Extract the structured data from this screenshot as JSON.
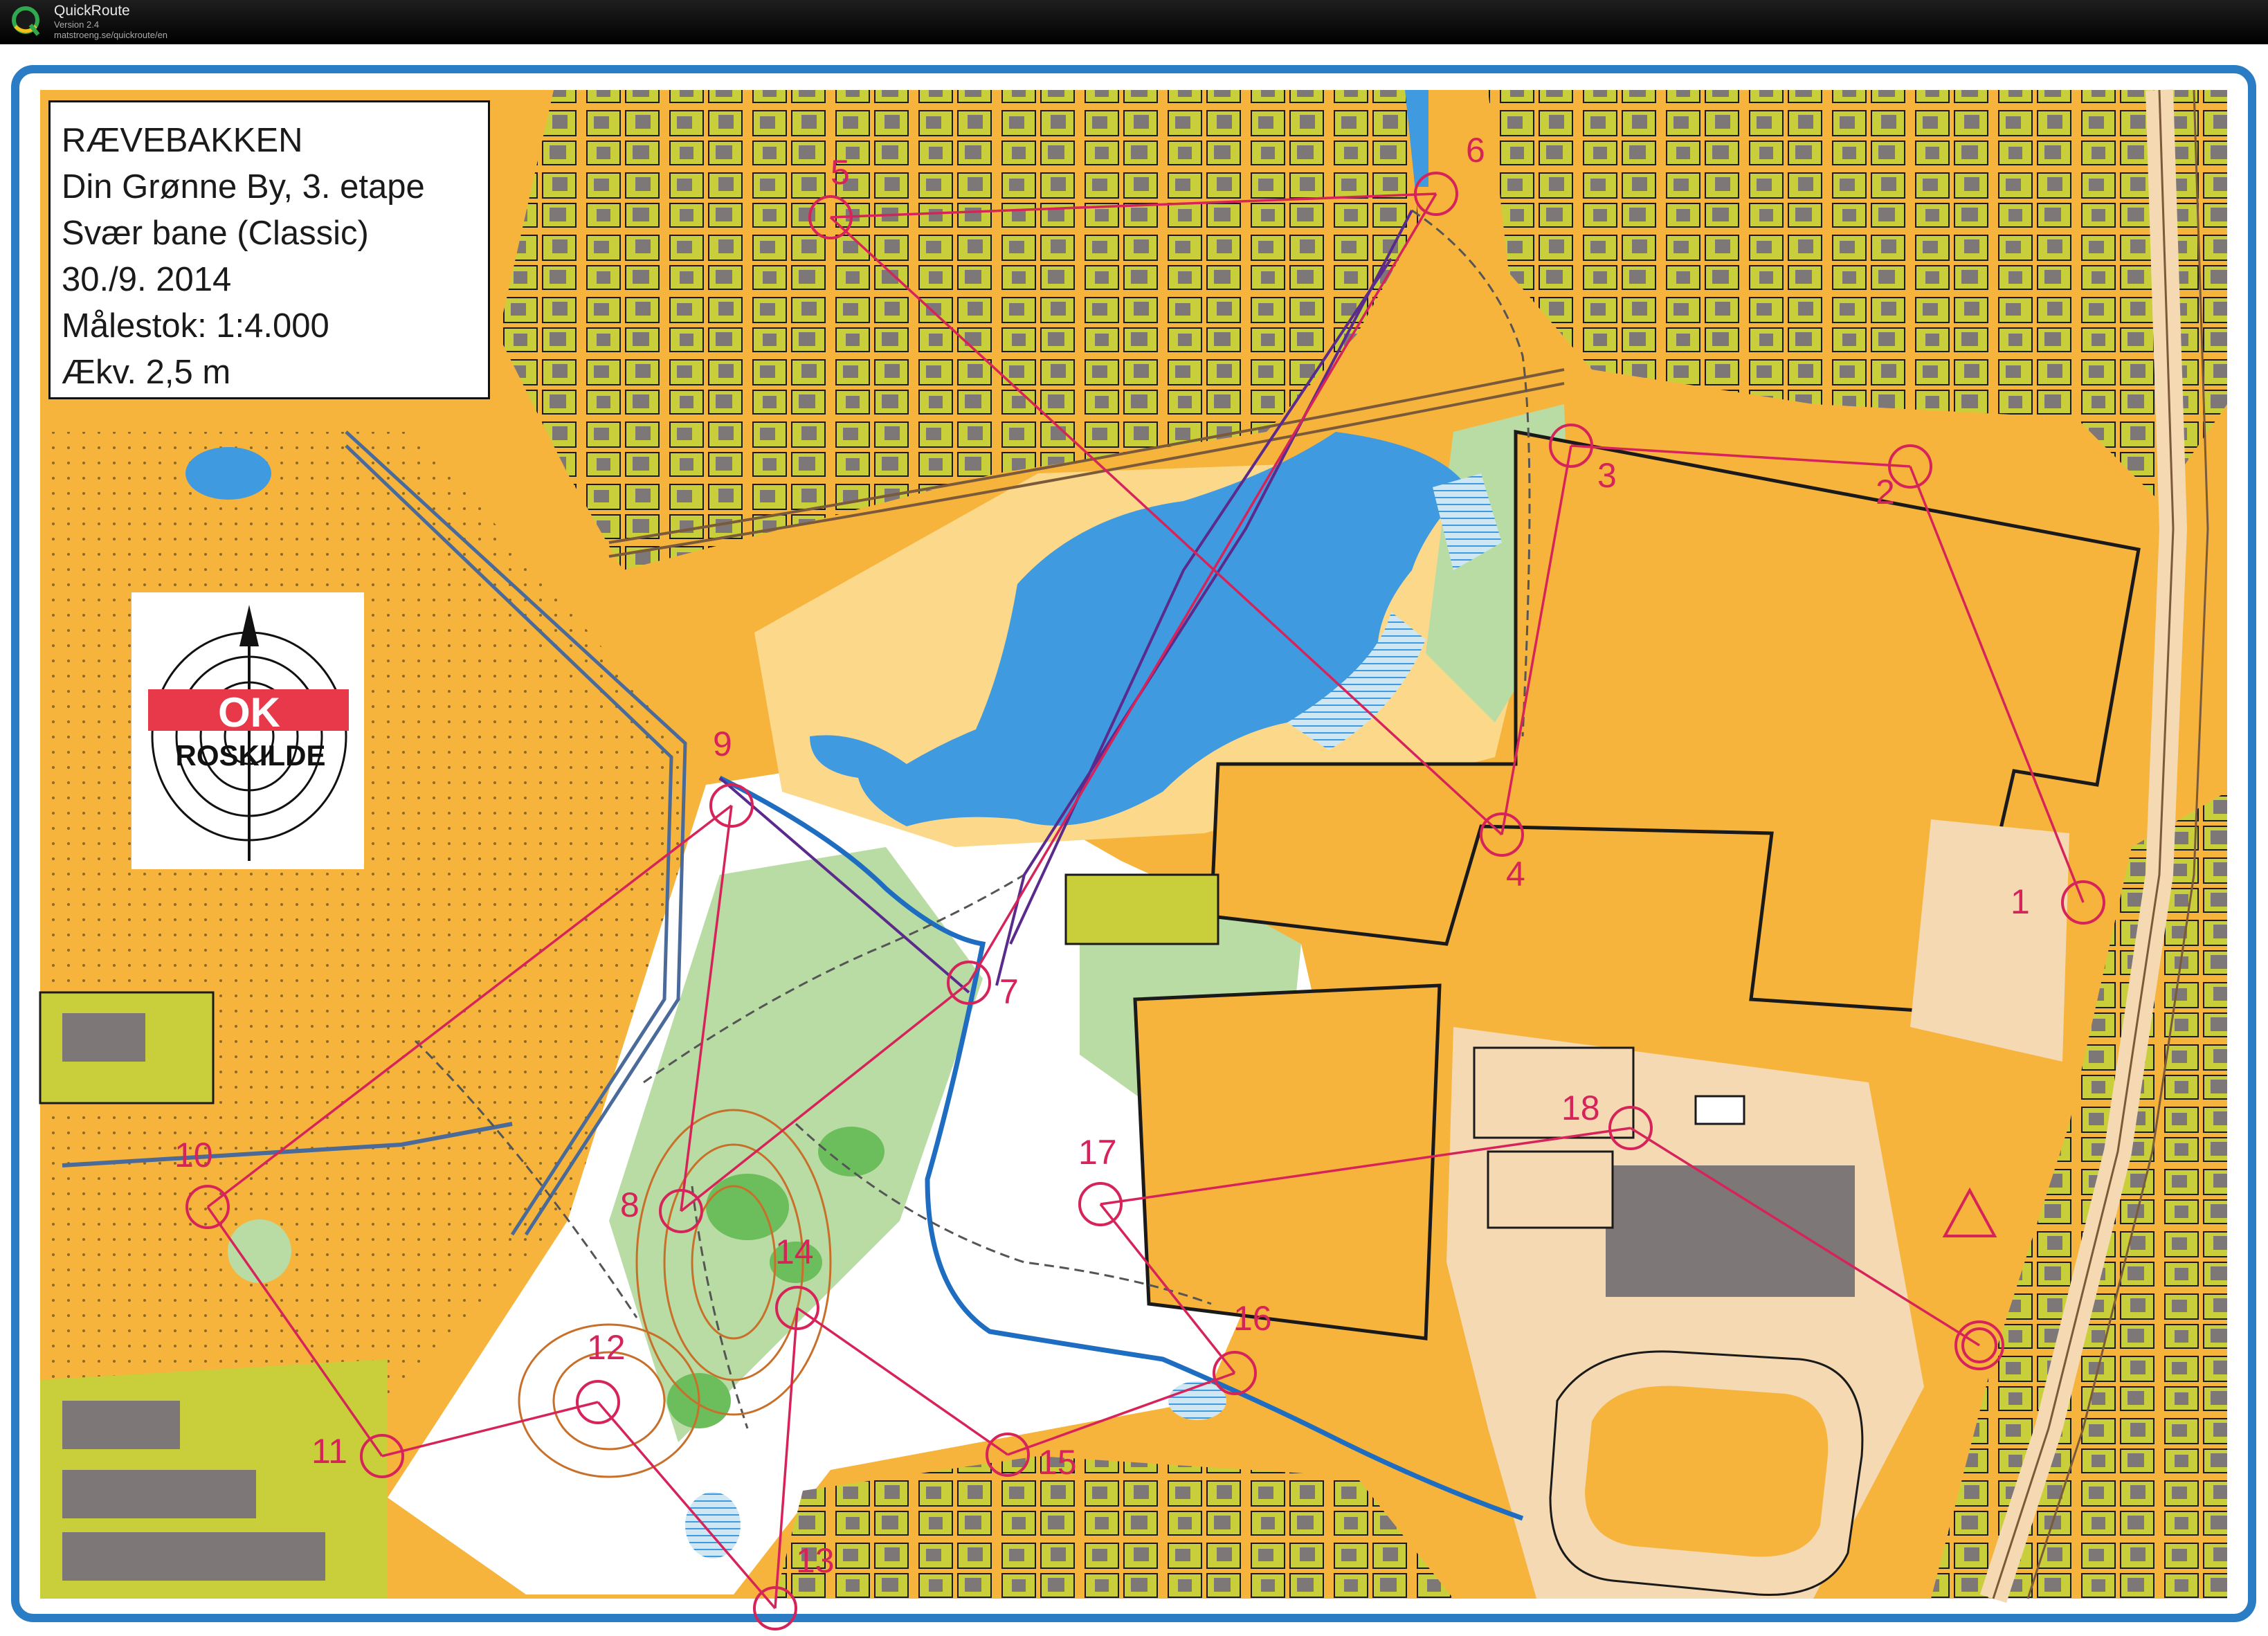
{
  "app": {
    "name": "QuickRoute",
    "version": "Version 2.4",
    "url": "matstroeng.se/quickroute/en"
  },
  "legend": {
    "title": "RÆVEBAKKEN",
    "event": "Din Grønne By, 3. etape",
    "course": "Svær bane (Classic)",
    "date": "30./9. 2014",
    "scale": "Målestok: 1:4.000",
    "contour": "Ækv. 2,5 m"
  },
  "club_logo": {
    "badge_text": "OK",
    "name": "ROSKILDE",
    "icon": "compass-arrow-icon"
  },
  "controls": [
    "1",
    "2",
    "3",
    "4",
    "5",
    "6",
    "7",
    "8",
    "9",
    "10",
    "11",
    "12",
    "13",
    "14",
    "15",
    "16",
    "17",
    "18"
  ],
  "colors": {
    "frame": "#2a7cc4",
    "open_land": "#f7b43c",
    "rough_open": "#fcd98a",
    "forest": "#ffffff",
    "green": "#b8dca4",
    "dark_green": "#6cbd5c",
    "water": "#3f9ae0",
    "building": "#7d7777",
    "garden": "#c9cf3a",
    "paved": "#f4d9b2",
    "course": "#d6245a",
    "route": "#5a2b8c",
    "ditch": "#1f6dc0",
    "titlebar": "#000000"
  }
}
